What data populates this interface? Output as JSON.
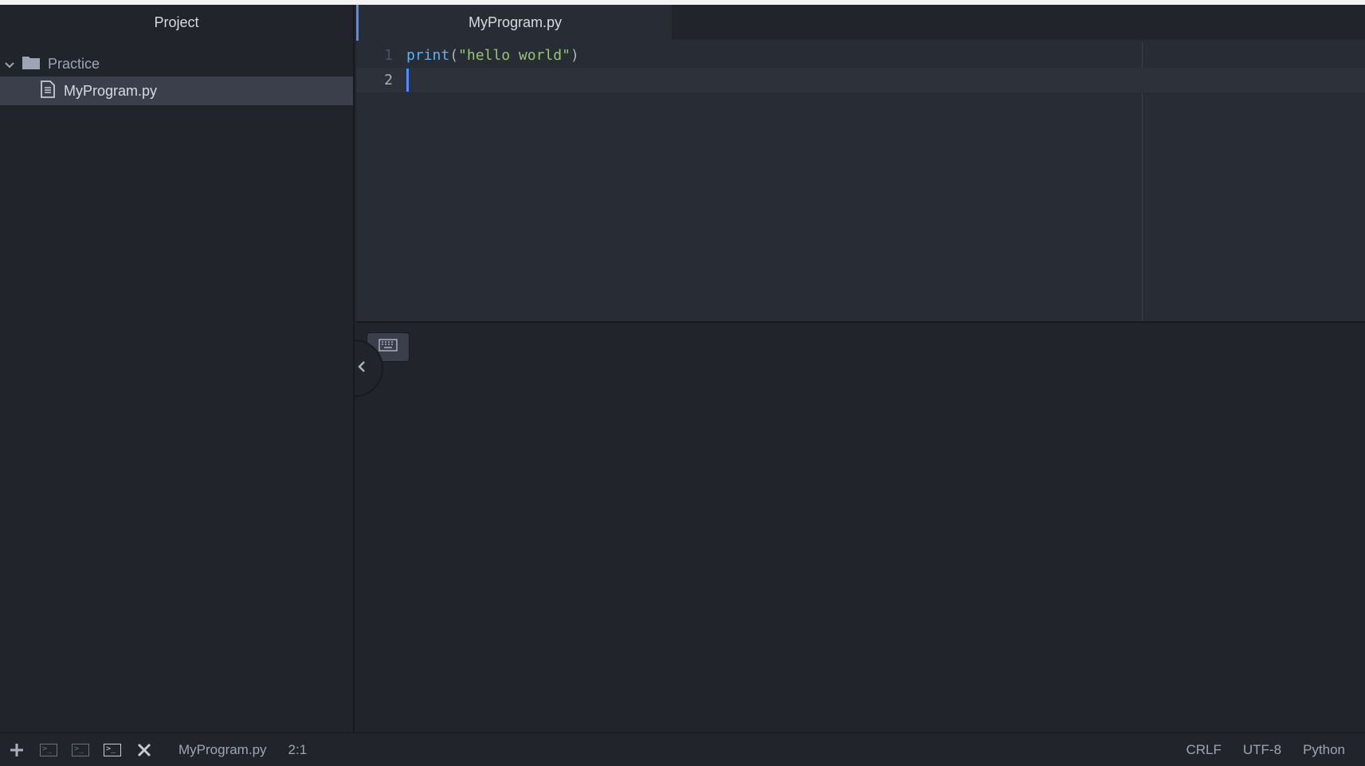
{
  "sidebar": {
    "title": "Project",
    "folder": "Practice",
    "file": "MyProgram.py"
  },
  "editor": {
    "tab": "MyProgram.py",
    "lines": [
      {
        "num": "1",
        "fn": "print",
        "open": "(",
        "str": "\"hello world\"",
        "close": ")"
      },
      {
        "num": "2"
      }
    ]
  },
  "status": {
    "file": "MyProgram.py",
    "cursor": "2:1",
    "line_ending": "CRLF",
    "encoding": "UTF-8",
    "grammar": "Python"
  },
  "colors": {
    "accent": "#568af2",
    "background": "#21252b",
    "editor": "#282c34"
  }
}
